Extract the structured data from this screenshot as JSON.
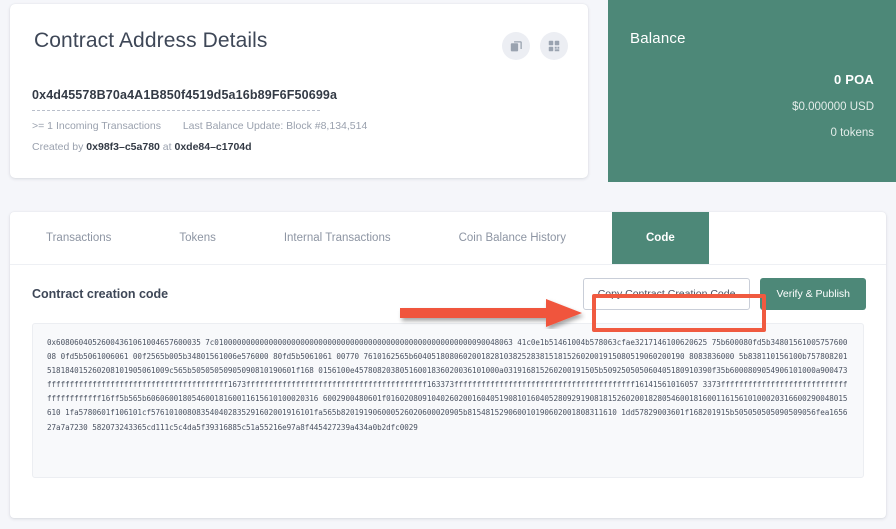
{
  "details": {
    "title": "Contract Address Details",
    "address": "0x4d45578B70a4A1B850f4519d5a16b89F6F50699a",
    "incoming_transactions": ">= 1 Incoming Transactions",
    "last_balance_update": "Last Balance Update: Block #8,134,514",
    "created_by_label": "Created by",
    "created_by_address": "0x98f3–c5a780",
    "created_at_label": "at",
    "created_at_tx": "0xde84–c1704d",
    "copy_icon": "copy-icon",
    "qr_icon": "qr-code-icon"
  },
  "balance": {
    "label": "Balance",
    "amount": "0 POA",
    "usd": "$0.000000 USD",
    "tokens": "0 tokens",
    "bg_color": "#4d8878"
  },
  "tabs": [
    {
      "label": "Transactions",
      "active": false
    },
    {
      "label": "Tokens",
      "active": false
    },
    {
      "label": "Internal Transactions",
      "active": false
    },
    {
      "label": "Coin Balance History",
      "active": false
    },
    {
      "label": "Code",
      "active": true
    }
  ],
  "code_section": {
    "title": "Contract creation code",
    "copy_button": "Copy Contract Creation Code",
    "verify_button": "Verify & Publish",
    "creation_code": "0x60806040526004361061004657600035 7c010000000000000000000000000000000000000000000000000000000090048063 41c0e1b51461004b578063cfae3217146100620625 75b600080fd5b3480156100575760008 0fd5b5061006061 00f2565b005b34801561006e576000 80fd5b5061061 00770 7610162565b604051808060200182810382528381518152602001915080519060200190 8083836000 5b838110156100b757808201518184015260208101905061009c565b50505050905090810190601f168 0156100e45780820380516001836020036101000a031916815260200191505b509250505060405180910390f35b6000809054906101000a900473ffffffffffffffffffffffffffffffffffffffff1673ffffffffffffffffffffffffffffffffffffffff163373ffffffffffffffffffffffffffffffffffffffff16141561016057 3373ffffffffffffffffffffffffffffffffffffffff16ff5b565b60606001805460018160011615610100020316 6002900480601f016020809104026020016040519081016040528092919081815260200182805460018160011615610100020316600290048015610 1fa5780601f106101cf576101008083540402835291602001916101fa565b820191906000526020600020905b815481529060010190602001808311610 1dd57829003601f168201915b505050505090509056fea165627a7a7230 582073243365cd111c5c4da5f39316885c51a55216e97a8f445427239a434a0b2dfc0029"
  },
  "annotations": {
    "arrow_color": "#f05a40",
    "highlight_color": "#f05a40",
    "arrow_name": "red-arrow-annotation",
    "highlight_name": "red-highlight-box-annotation"
  }
}
